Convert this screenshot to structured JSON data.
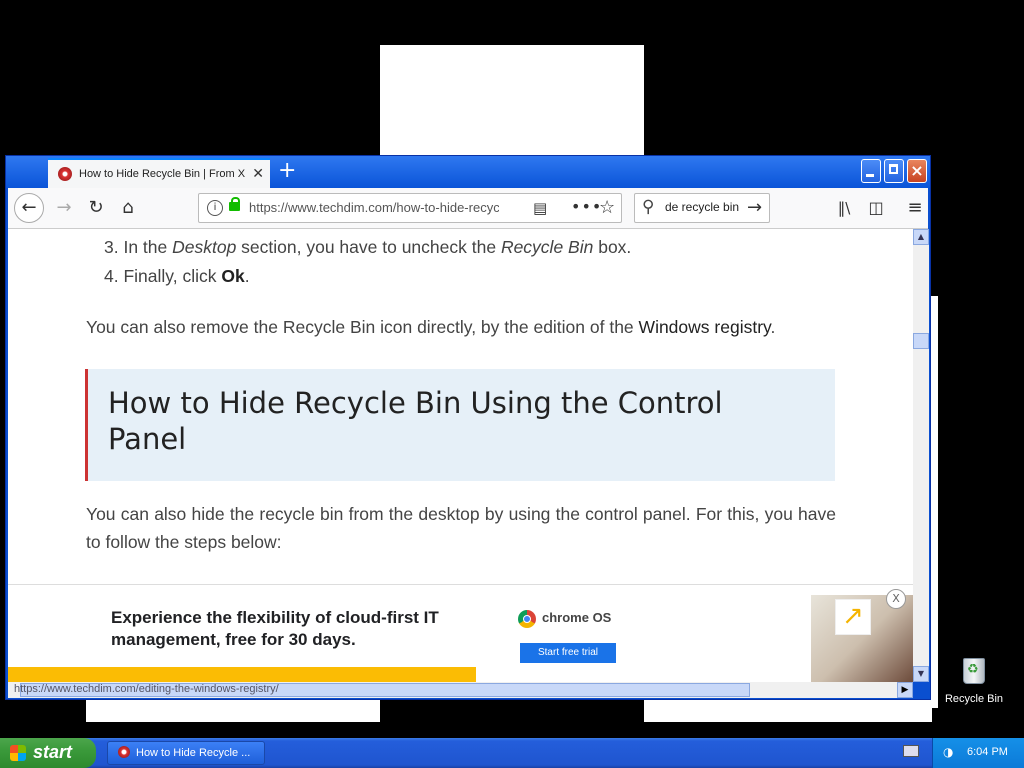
{
  "browser": {
    "tab_title": "How to Hide Recycle Bin | From XP to...",
    "tab_close": "✕",
    "new_tab": "+",
    "url": "https://www.techdim.com/how-to-hide-recycle-bin/",
    "search_value": "de recycle bin"
  },
  "content": {
    "steps": [
      {
        "prefix": "3. In the ",
        "em1": "Desktop",
        "mid": " section, you have to uncheck the ",
        "em2": "Recycle Bin",
        "suffix": " box."
      },
      {
        "prefix": "4. Finally, click ",
        "strong": "Ok",
        "suffix": "."
      }
    ],
    "para1_text": "You can also remove the Recycle Bin icon directly, by the edition of the ",
    "para1_link": "Windows registry",
    "para1_end": ".",
    "heading": "How to Hide Recycle Bin Using the Control Panel",
    "para2": "You can also hide the recycle bin from the desktop by using the control panel. For this, you have to follow the steps below:"
  },
  "ad": {
    "headline": "Experience the flexibility of cloud-first IT management, free for 30 days.",
    "brand": "chrome OS",
    "cta": "Start free trial",
    "close": "X"
  },
  "status_url": "https://www.techdim.com/editing-the-windows-registry/",
  "desktop": {
    "recycle_bin_label": "Recycle Bin"
  },
  "taskbar": {
    "start_label": "start",
    "task_title": "How to Hide Recycle ...",
    "clock": "6:04 PM"
  },
  "colors": {
    "xp_blue": "#245edb",
    "start_green": "#3b9a3b",
    "heading_bg": "#e6f0f8",
    "heading_accent": "#cc3333",
    "ad_yellow": "#fbbc04"
  }
}
